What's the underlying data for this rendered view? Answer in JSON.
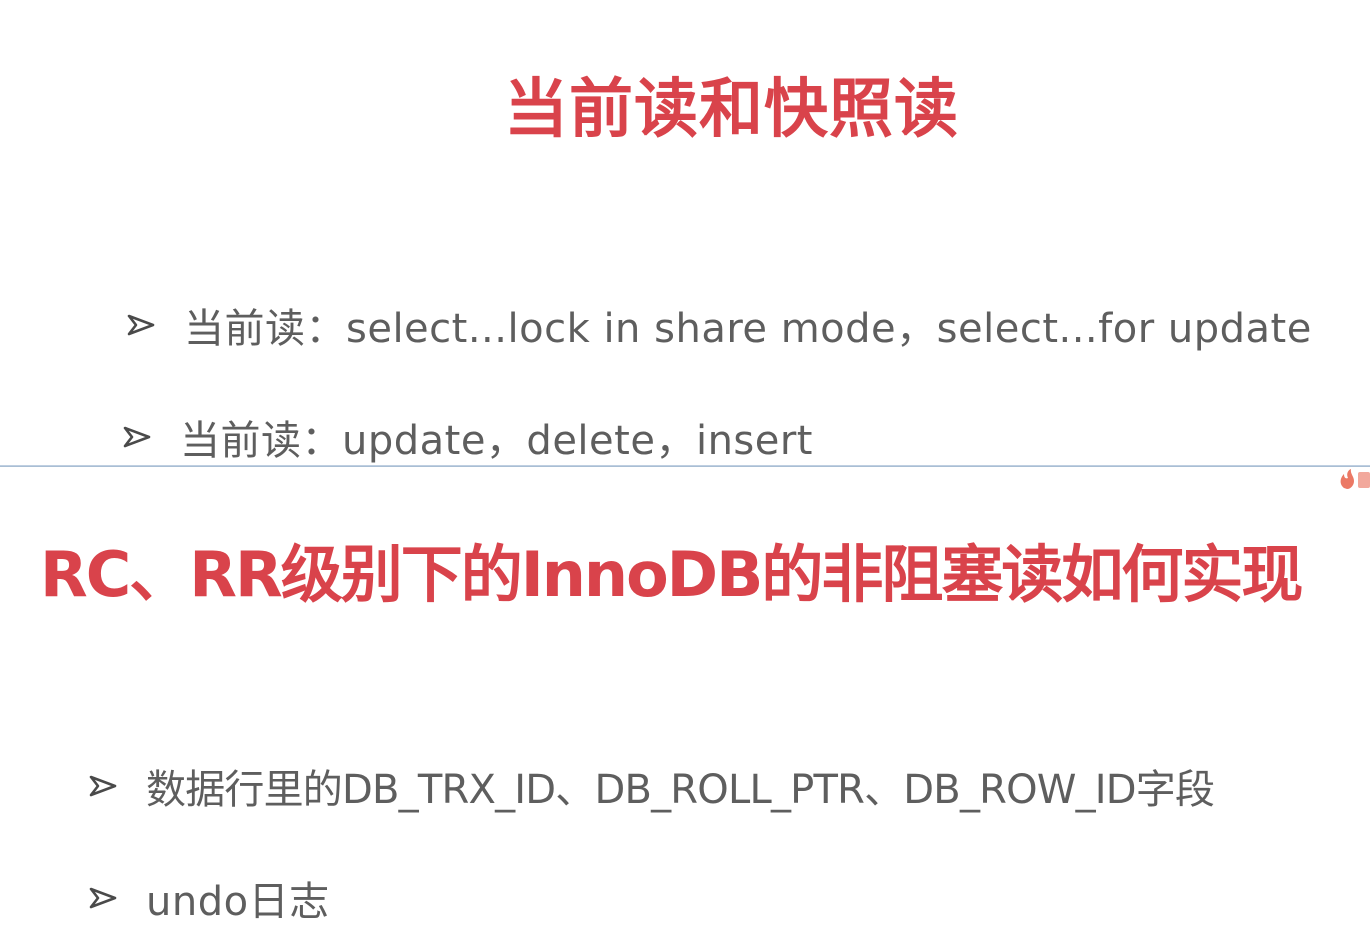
{
  "top_slide": {
    "title": "当前读和快照读",
    "bullets": [
      {
        "icon": "arrow-bullet-icon",
        "text": "当前读：select...lock in share mode，select...for update"
      },
      {
        "icon": "arrow-bullet-icon",
        "text": "当前读：update，delete，insert"
      }
    ]
  },
  "bottom_slide": {
    "title": "RC、RR级别下的InnoDB的非阻塞读如何实现",
    "bullets": [
      {
        "icon": "arrow-bullet-icon",
        "text": "数据行里的DB_TRX_ID、DB_ROLL_PTR、DB_ROW_ID字段"
      },
      {
        "icon": "arrow-bullet-icon",
        "text": "undo日志"
      }
    ]
  },
  "colors": {
    "title": "#d9434b",
    "body_text": "#5e5e5e",
    "bullet": "#4a4a4a",
    "divider": "#9fb6cf",
    "logo": "#e8614a"
  },
  "logo_icon": "flame-logo-icon"
}
